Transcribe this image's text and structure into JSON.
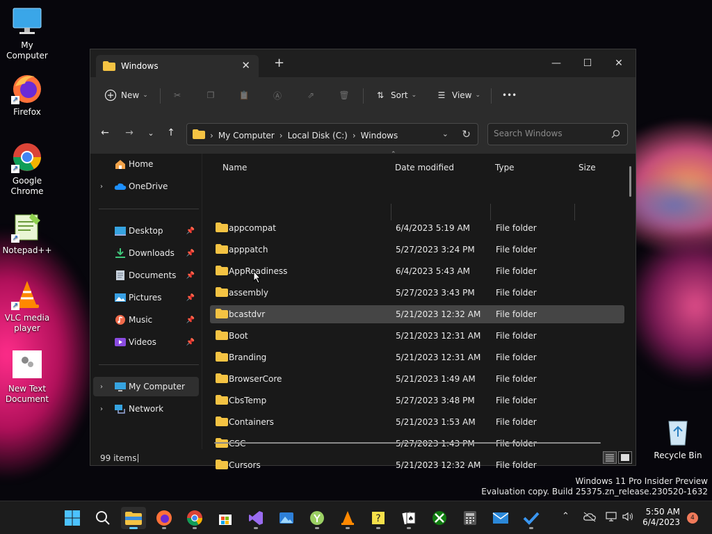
{
  "desktop": {
    "icons": [
      {
        "label": "My Computer"
      },
      {
        "label": "Firefox"
      },
      {
        "label": "Google Chrome"
      },
      {
        "label": "Notepad++"
      },
      {
        "label": "VLC media player"
      },
      {
        "label": "New Text Document"
      },
      {
        "label": "Recycle Bin"
      }
    ],
    "watermark": {
      "line1": "Windows 11 Pro Insider Preview",
      "line2": "Evaluation copy. Build 25375.zn_release.230520-1632"
    }
  },
  "window": {
    "tab_title": "Windows",
    "new_tab": "+",
    "controls": {
      "minimize": "—",
      "maximize": "☐",
      "close": "✕"
    },
    "toolbar": {
      "new_label": "New",
      "sort_label": "Sort",
      "view_label": "View",
      "more_label": "•••"
    },
    "breadcrumb": [
      "My Computer",
      "Local Disk (C:)",
      "Windows"
    ],
    "search_placeholder": "Search Windows",
    "nav": {
      "home": "Home",
      "onedrive": "OneDrive",
      "quick_access": [
        "Desktop",
        "Downloads",
        "Documents",
        "Pictures",
        "Music",
        "Videos"
      ],
      "my_computer": "My Computer",
      "network": "Network"
    },
    "columns": {
      "name": "Name",
      "date": "Date modified",
      "type": "Type",
      "size": "Size"
    },
    "rows": [
      {
        "name": "appcompat",
        "date": "6/4/2023 5:19 AM",
        "type": "File folder"
      },
      {
        "name": "apppatch",
        "date": "5/27/2023 3:24 PM",
        "type": "File folder"
      },
      {
        "name": "AppReadiness",
        "date": "6/4/2023 5:43 AM",
        "type": "File folder"
      },
      {
        "name": "assembly",
        "date": "5/27/2023 3:43 PM",
        "type": "File folder"
      },
      {
        "name": "bcastdvr",
        "date": "5/21/2023 12:32 AM",
        "type": "File folder"
      },
      {
        "name": "Boot",
        "date": "5/21/2023 12:31 AM",
        "type": "File folder"
      },
      {
        "name": "Branding",
        "date": "5/21/2023 12:31 AM",
        "type": "File folder"
      },
      {
        "name": "BrowserCore",
        "date": "5/21/2023 1:49 AM",
        "type": "File folder"
      },
      {
        "name": "CbsTemp",
        "date": "5/27/2023 3:48 PM",
        "type": "File folder"
      },
      {
        "name": "Containers",
        "date": "5/21/2023 1:53 AM",
        "type": "File folder"
      },
      {
        "name": "CSC",
        "date": "5/27/2023 1:43 PM",
        "type": "File folder"
      },
      {
        "name": "Cursors",
        "date": "5/21/2023 12:32 AM",
        "type": "File folder"
      }
    ],
    "status": {
      "count": "99 items"
    }
  },
  "taskbar": {
    "time": "5:50 AM",
    "date": "6/4/2023",
    "notifications": "4"
  },
  "colors": {
    "folder": "#f4c343",
    "accent": "#60cdff"
  }
}
